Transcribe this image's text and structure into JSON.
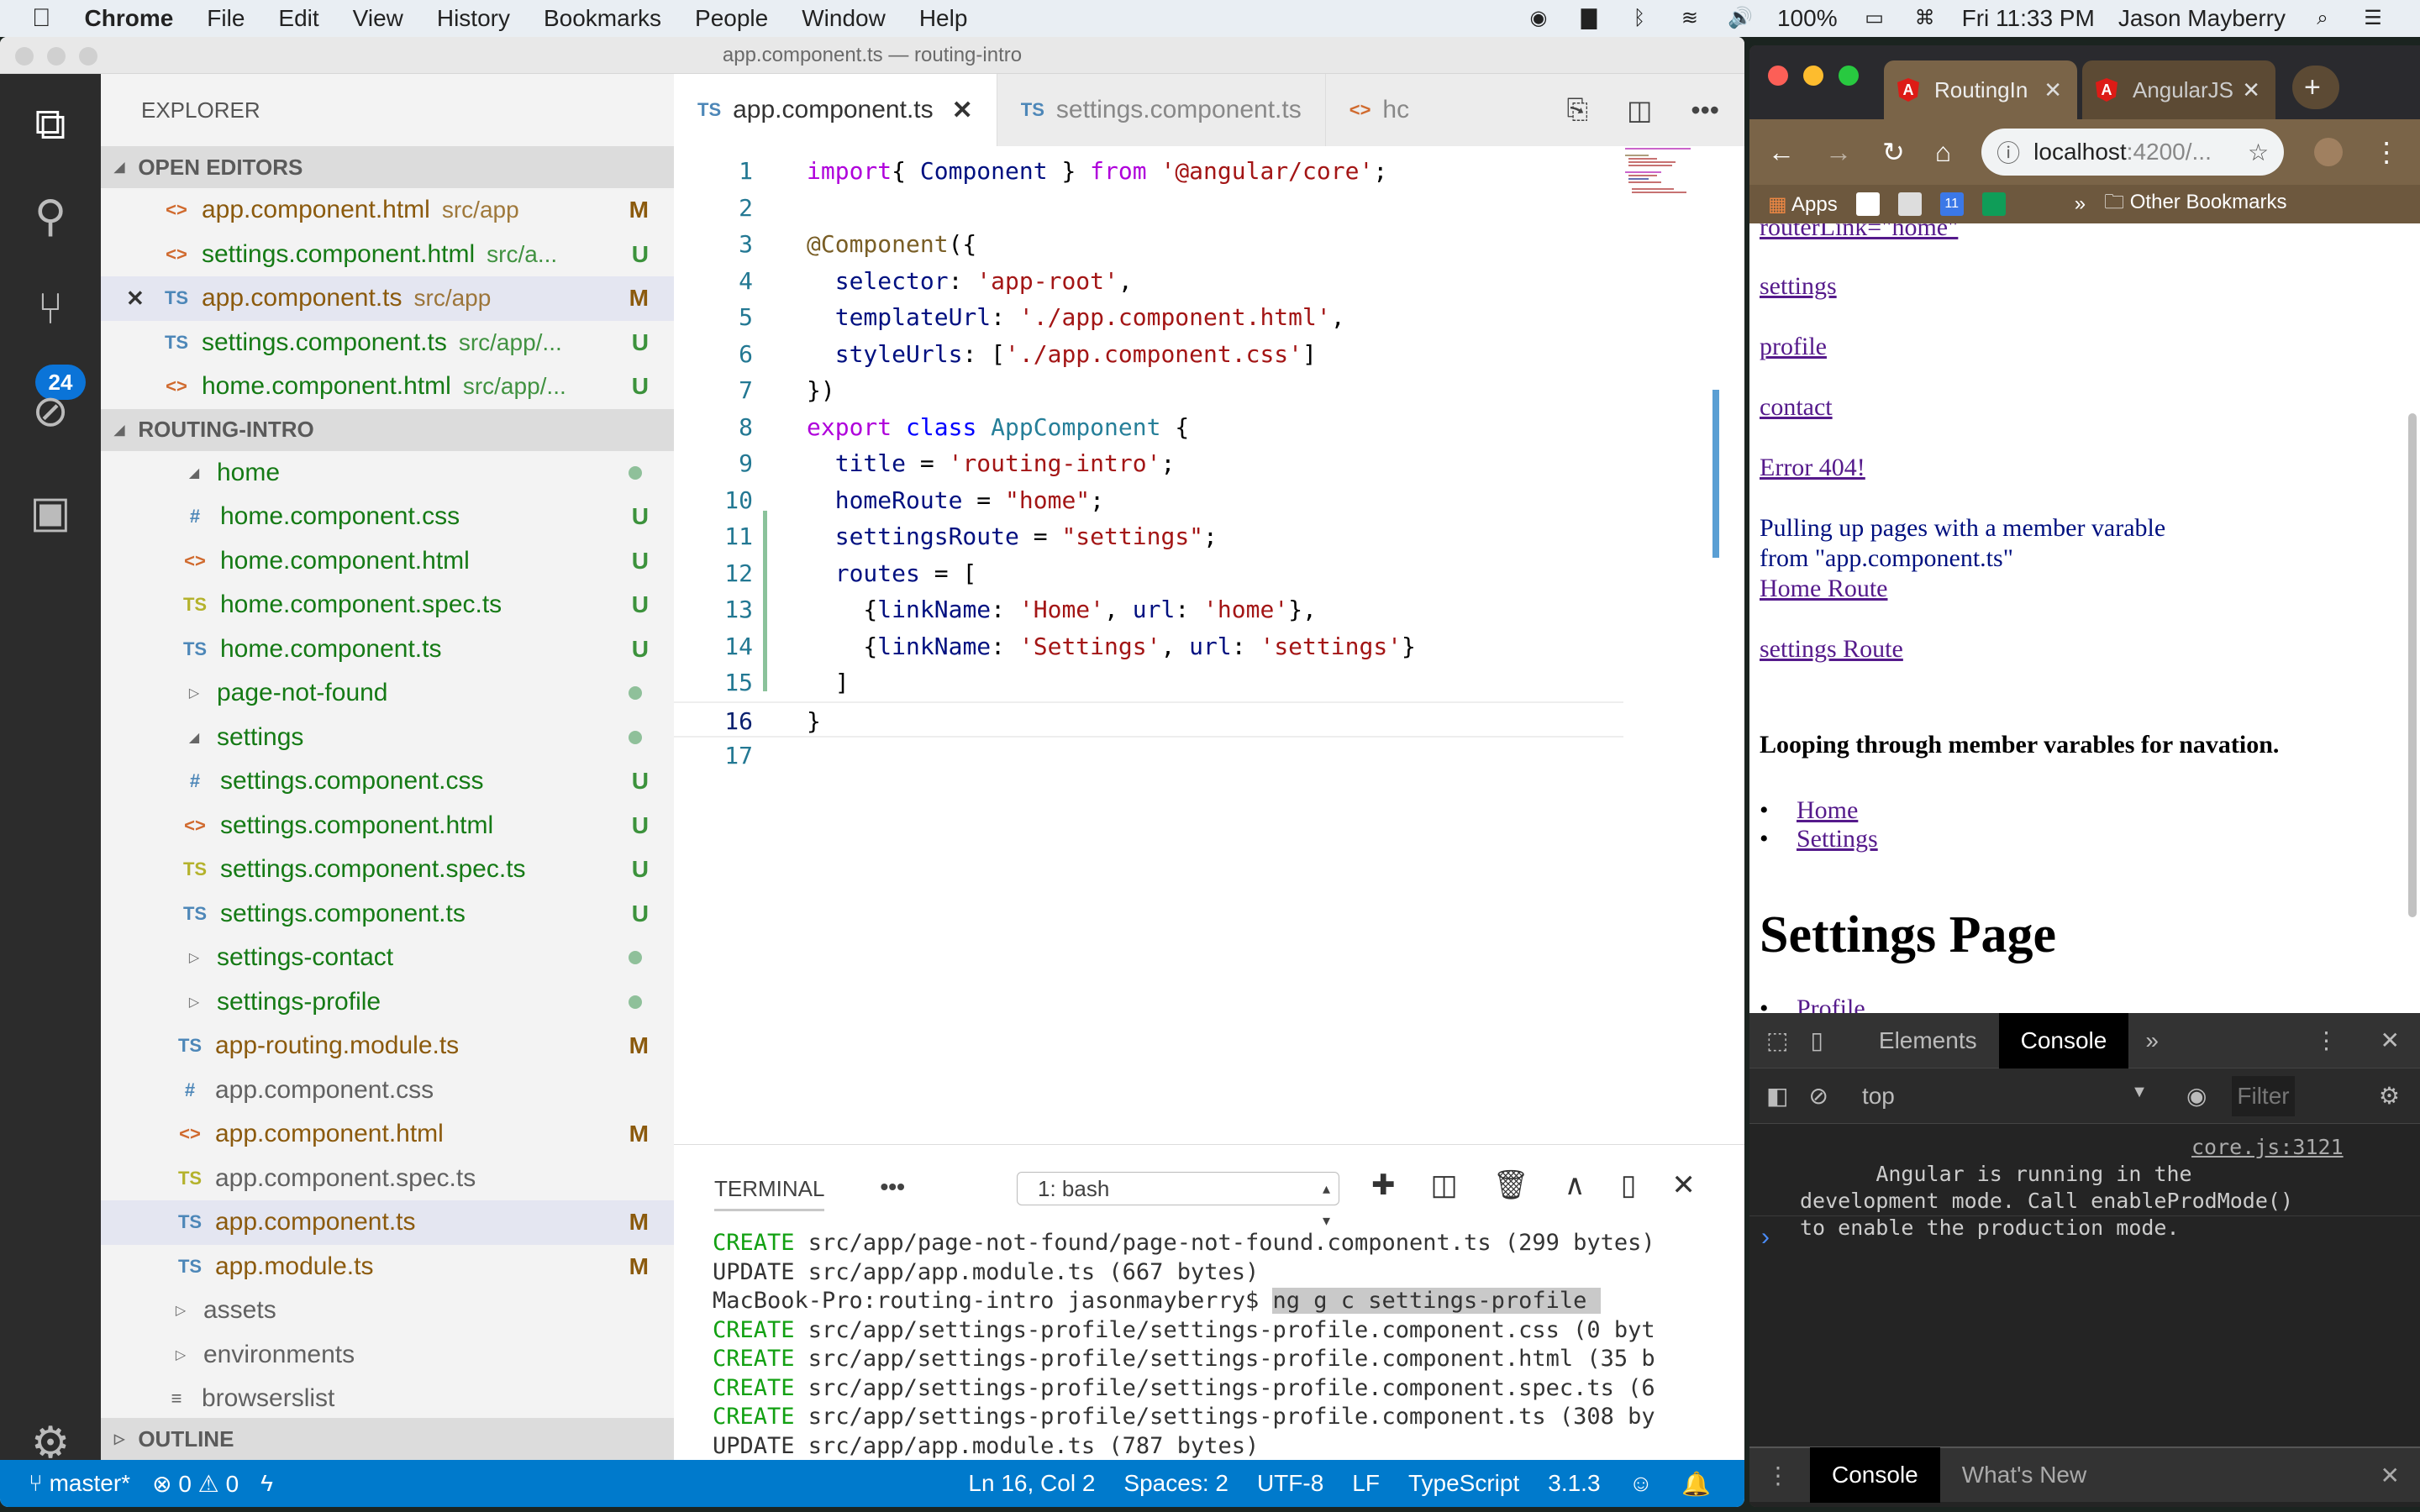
{
  "menubar": {
    "apple": "",
    "app": "Chrome",
    "items": [
      "File",
      "Edit",
      "View",
      "History",
      "Bookmarks",
      "People",
      "Window",
      "Help"
    ],
    "battery": "100%",
    "clock": "Fri 11:33 PM",
    "user": "Jason Mayberry"
  },
  "vscode": {
    "window_title": "app.component.ts — routing-intro",
    "explorer_title": "EXPLORER",
    "scm_badge": "24",
    "open_editors": {
      "label": "OPEN EDITORS",
      "items": [
        {
          "icon": "html",
          "name": "app.component.html",
          "path": "src/app",
          "status": "M",
          "color": "m"
        },
        {
          "icon": "html",
          "name": "settings.component.html",
          "path": "src/a...",
          "status": "U",
          "color": "u"
        },
        {
          "icon": "ts",
          "name": "app.component.ts",
          "path": "src/app",
          "status": "M",
          "color": "m",
          "active": true
        },
        {
          "icon": "ts",
          "name": "settings.component.ts",
          "path": "src/app/...",
          "status": "U",
          "color": "u"
        },
        {
          "icon": "html",
          "name": "home.component.html",
          "path": "src/app/...",
          "status": "U",
          "color": "u"
        }
      ]
    },
    "project": {
      "label": "ROUTING-INTRO",
      "tree": [
        {
          "type": "folder",
          "open": true,
          "name": "home",
          "depth": 2,
          "dot": true,
          "color": "u"
        },
        {
          "icon": "css",
          "name": "home.component.css",
          "depth": 3,
          "status": "U",
          "color": "u"
        },
        {
          "icon": "html",
          "name": "home.component.html",
          "depth": 3,
          "status": "U",
          "color": "u"
        },
        {
          "icon": "spec",
          "name": "home.component.spec.ts",
          "depth": 3,
          "status": "U",
          "color": "u"
        },
        {
          "icon": "ts",
          "name": "home.component.ts",
          "depth": 3,
          "status": "U",
          "color": "u"
        },
        {
          "type": "folder",
          "open": false,
          "name": "page-not-found",
          "depth": 2,
          "dot": true,
          "color": "u"
        },
        {
          "type": "folder",
          "open": true,
          "name": "settings",
          "depth": 2,
          "dot": true,
          "color": "u"
        },
        {
          "icon": "css",
          "name": "settings.component.css",
          "depth": 3,
          "status": "U",
          "color": "u"
        },
        {
          "icon": "html",
          "name": "settings.component.html",
          "depth": 3,
          "status": "U",
          "color": "u"
        },
        {
          "icon": "spec",
          "name": "settings.component.spec.ts",
          "depth": 3,
          "status": "U",
          "color": "u"
        },
        {
          "icon": "ts",
          "name": "settings.component.ts",
          "depth": 3,
          "status": "U",
          "color": "u"
        },
        {
          "type": "folder",
          "open": false,
          "name": "settings-contact",
          "depth": 2,
          "dot": true,
          "color": "u"
        },
        {
          "type": "folder",
          "open": false,
          "name": "settings-profile",
          "depth": 2,
          "dot": true,
          "color": "u"
        },
        {
          "icon": "ts",
          "name": "app-routing.module.ts",
          "depth": 2,
          "status": "M",
          "color": "m"
        },
        {
          "icon": "css",
          "name": "app.component.css",
          "depth": 2,
          "color": "g"
        },
        {
          "icon": "html",
          "name": "app.component.html",
          "depth": 2,
          "status": "M",
          "color": "m"
        },
        {
          "icon": "spec",
          "name": "app.component.spec.ts",
          "depth": 2,
          "color": "g"
        },
        {
          "icon": "ts",
          "name": "app.component.ts",
          "depth": 2,
          "status": "M",
          "color": "m",
          "active": true
        },
        {
          "icon": "ts",
          "name": "app.module.ts",
          "depth": 2,
          "status": "M",
          "color": "m"
        },
        {
          "type": "folder",
          "open": false,
          "name": "assets",
          "depth": 1,
          "color": "g"
        },
        {
          "type": "folder",
          "open": false,
          "name": "environments",
          "depth": 1,
          "color": "g"
        },
        {
          "icon": "file",
          "name": "browserslist",
          "depth": 1,
          "color": "g"
        }
      ]
    },
    "outline_label": "OUTLINE",
    "tabs": [
      {
        "icon": "TS",
        "label": "app.component.ts",
        "active": true
      },
      {
        "icon": "TS",
        "label": "settings.component.ts",
        "active": false
      },
      {
        "icon": "<>",
        "label": "hc",
        "active": false
      }
    ],
    "code_lines": [
      [
        [
          "k",
          "import"
        ],
        [
          "",
          "{ "
        ],
        [
          "p",
          "Component"
        ],
        [
          "",
          " } "
        ],
        [
          "k",
          "from"
        ],
        [
          "",
          " "
        ],
        [
          "s",
          "'@angular/core'"
        ],
        [
          "",
          ";"
        ]
      ],
      [],
      [
        [
          "d",
          "@Component"
        ],
        [
          "",
          "({"
        ]
      ],
      [
        [
          "",
          "  "
        ],
        [
          "p",
          "selector"
        ],
        [
          "",
          ": "
        ],
        [
          "s",
          "'app-root'"
        ],
        [
          "",
          ","
        ]
      ],
      [
        [
          "",
          "  "
        ],
        [
          "p",
          "templateUrl"
        ],
        [
          "",
          ": "
        ],
        [
          "s",
          "'./app.component.html'"
        ],
        [
          "",
          ","
        ]
      ],
      [
        [
          "",
          "  "
        ],
        [
          "p",
          "styleUrls"
        ],
        [
          "",
          ": ["
        ],
        [
          "s",
          "'./app.component.css'"
        ],
        [
          "",
          "]"
        ]
      ],
      [
        [
          "",
          "})"
        ]
      ],
      [
        [
          "k",
          "export"
        ],
        [
          "",
          " "
        ],
        [
          "b",
          "class"
        ],
        [
          "",
          " "
        ],
        [
          "t",
          "AppComponent"
        ],
        [
          "",
          " {"
        ]
      ],
      [
        [
          "",
          "  "
        ],
        [
          "p",
          "title"
        ],
        [
          "",
          " = "
        ],
        [
          "s",
          "'routing-intro'"
        ],
        [
          "",
          ";"
        ]
      ],
      [
        [
          "",
          "  "
        ],
        [
          "p",
          "homeRoute"
        ],
        [
          "",
          " = "
        ],
        [
          "s",
          "\"home\""
        ],
        [
          "",
          ";"
        ]
      ],
      [
        [
          "",
          "  "
        ],
        [
          "p",
          "settingsRoute"
        ],
        [
          "",
          " = "
        ],
        [
          "s",
          "\"settings\""
        ],
        [
          "",
          ";"
        ]
      ],
      [
        [
          "",
          "  "
        ],
        [
          "p",
          "routes"
        ],
        [
          "",
          " = ["
        ]
      ],
      [
        [
          "",
          "    {"
        ],
        [
          "p",
          "linkName"
        ],
        [
          "",
          ": "
        ],
        [
          "s",
          "'Home'"
        ],
        [
          "",
          ", "
        ],
        [
          "p",
          "url"
        ],
        [
          "",
          ": "
        ],
        [
          "s",
          "'home'"
        ],
        [
          "",
          "},"
        ]
      ],
      [
        [
          "",
          "    {"
        ],
        [
          "p",
          "linkName"
        ],
        [
          "",
          ": "
        ],
        [
          "s",
          "'Settings'"
        ],
        [
          "",
          ", "
        ],
        [
          "p",
          "url"
        ],
        [
          "",
          ": "
        ],
        [
          "s",
          "'settings'"
        ],
        [
          "",
          "}"
        ]
      ],
      [
        [
          "",
          "  ]"
        ]
      ],
      [
        [
          "",
          "}"
        ]
      ],
      []
    ],
    "terminal": {
      "label": "TERMINAL",
      "shell_select": "1: bash",
      "lines": [
        {
          "tag": "CREATE",
          "text": " src/app/page-not-found/page-not-found.component.ts (299 bytes)"
        },
        {
          "tag": "UPDATE",
          "text": " src/app/app.module.ts (667 bytes)"
        },
        {
          "prompt": "MacBook-Pro:routing-intro jasonmayberry$ ",
          "cmd": "ng g c settings-profile "
        },
        {
          "tag": "CREATE",
          "text": " src/app/settings-profile/settings-profile.component.css (0 byt"
        },
        {
          "tag": "CREATE",
          "text": " src/app/settings-profile/settings-profile.component.html (35 b"
        },
        {
          "tag": "CREATE",
          "text": " src/app/settings-profile/settings-profile.component.spec.ts (6"
        },
        {
          "tag": "CREATE",
          "text": " src/app/settings-profile/settings-profile.component.ts (308 by"
        },
        {
          "tag": "UPDATE",
          "text": " src/app/app.module.ts (787 bytes)"
        }
      ]
    },
    "status": {
      "branch": "master*",
      "errors": "0",
      "warnings": "0",
      "position": "Ln 16, Col 2",
      "spaces": "Spaces: 2",
      "encoding": "UTF-8",
      "eol": "LF",
      "language": "TypeScript",
      "ts_version": "3.1.3"
    }
  },
  "chrome": {
    "tabs": [
      {
        "label": "RoutingIn",
        "active": true
      },
      {
        "label": "AngularJS",
        "active": false
      }
    ],
    "url_host": "localhost",
    "url_rest": ":4200/...",
    "bookmarks": {
      "apps": "Apps",
      "calendar_day": "11",
      "overflow": "»",
      "other": "Other Bookmarks"
    },
    "page": {
      "links_top": [
        "routerLink=\"home\"",
        "settings",
        "profile",
        "contact",
        "Error 404!"
      ],
      "para_line1": "Pulling up pages with a member varable",
      "para_line2": "from \"app.component.ts\"",
      "home_route": "Home Route",
      "settings_route": "settings Route",
      "loop_heading": "Looping through member varables for navation.",
      "loop_links": [
        "Home",
        "Settings"
      ],
      "settings_heading": "Settings Page",
      "settings_links": [
        "Profile"
      ]
    },
    "devtools": {
      "tabs": [
        "Elements",
        "Console"
      ],
      "active_tab": "Console",
      "context": "top",
      "filter_placeholder": "Filter",
      "message": "Angular is running in the\ndevelopment mode. Call enableProdMode()\nto enable the production mode.",
      "message_source": "core.js:3121",
      "drawer_tabs": [
        "Console",
        "What's New"
      ]
    }
  }
}
